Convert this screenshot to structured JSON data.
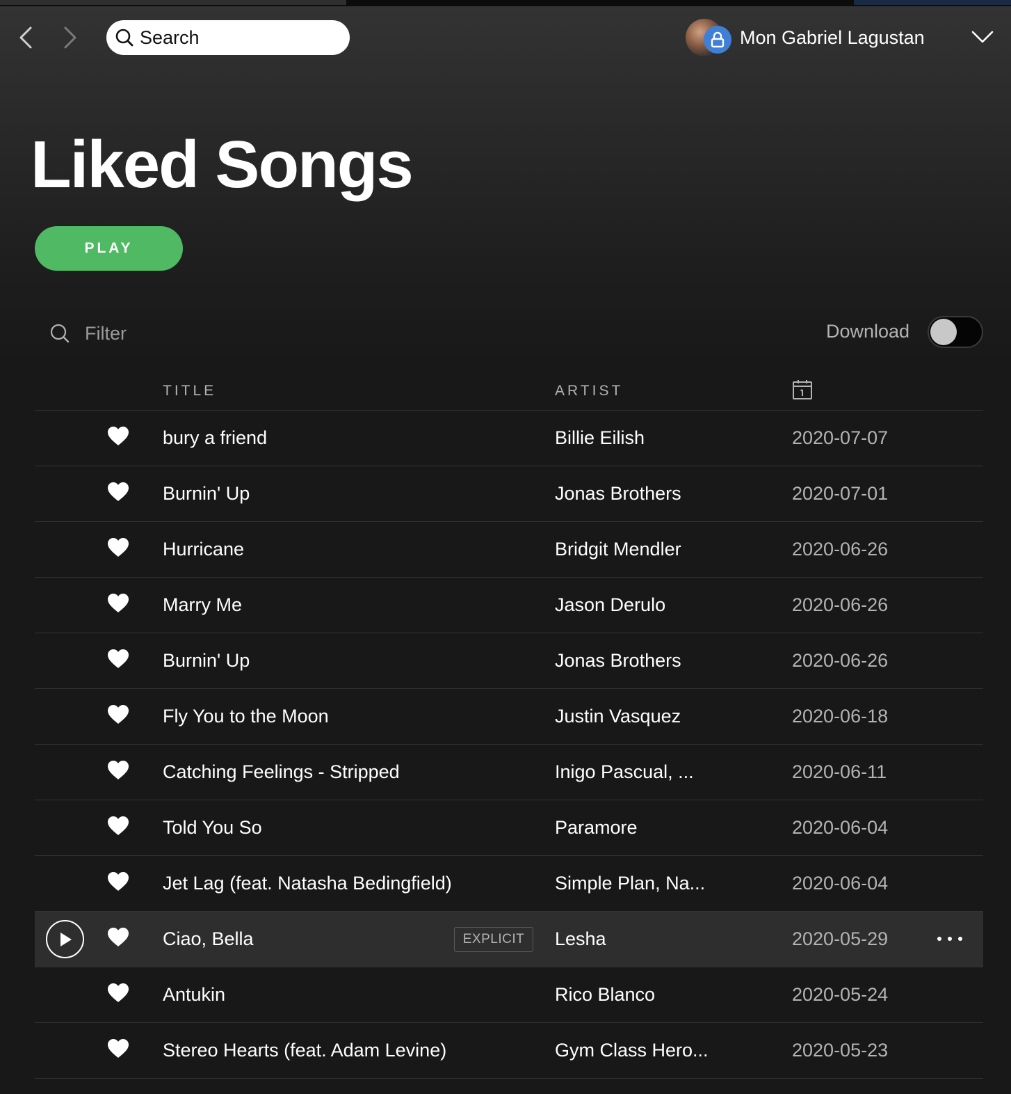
{
  "header": {
    "search_placeholder": "Search",
    "user_name": "Mon Gabriel Lagustan"
  },
  "page": {
    "title": "Liked Songs",
    "play_label": "PLAY",
    "filter_placeholder": "Filter",
    "download_label": "Download",
    "download_enabled": false
  },
  "table": {
    "columns": {
      "title": "TITLE",
      "artist": "ARTIST",
      "date_icon": "calendar-icon"
    },
    "rows": [
      {
        "title": "bury a friend",
        "artist": "Billie Eilish",
        "date": "2020-07-07",
        "liked": true
      },
      {
        "title": "Burnin' Up",
        "artist": "Jonas Brothers",
        "date": "2020-07-01",
        "liked": true
      },
      {
        "title": "Hurricane",
        "artist": "Bridgit Mendler",
        "date": "2020-06-26",
        "liked": true
      },
      {
        "title": "Marry Me",
        "artist": "Jason Derulo",
        "date": "2020-06-26",
        "liked": true
      },
      {
        "title": "Burnin' Up",
        "artist": "Jonas Brothers",
        "date": "2020-06-26",
        "liked": true
      },
      {
        "title": "Fly You to the Moon",
        "artist": "Justin Vasquez",
        "date": "2020-06-18",
        "liked": true
      },
      {
        "title": "Catching Feelings - Stripped",
        "artist": "Inigo Pascual, ...",
        "date": "2020-06-11",
        "liked": true
      },
      {
        "title": "Told You So",
        "artist": "Paramore",
        "date": "2020-06-04",
        "liked": true
      },
      {
        "title": "Jet Lag (feat. Natasha Bedingfield)",
        "artist": "Simple Plan, Na...",
        "date": "2020-06-04",
        "liked": true
      },
      {
        "title": "Ciao, Bella",
        "artist": "Lesha",
        "date": "2020-05-29",
        "liked": true,
        "explicit": "EXPLICIT",
        "hovered": true
      },
      {
        "title": "Antukin",
        "artist": "Rico Blanco",
        "date": "2020-05-24",
        "liked": true
      },
      {
        "title": "Stereo Hearts (feat. Adam Levine)",
        "artist": "Gym Class Hero...",
        "date": "2020-05-23",
        "liked": true
      }
    ]
  },
  "colors": {
    "accent_green": "#4fba63",
    "background": "#181818",
    "row_hover": "#2e2e2e",
    "lock_badge": "#3f7fd6"
  }
}
